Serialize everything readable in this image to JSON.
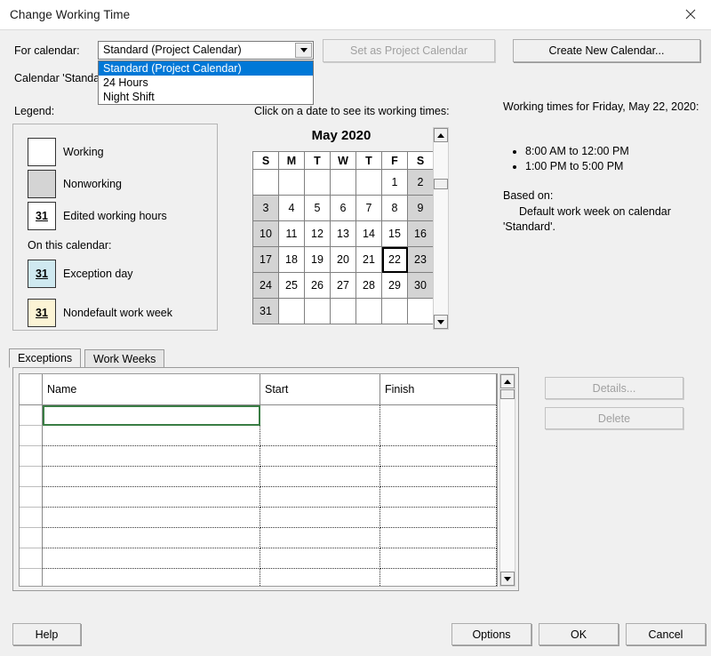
{
  "window": {
    "title": "Change Working Time",
    "close_icon": "close-icon"
  },
  "calendar_selector": {
    "label": "For calendar:",
    "value": "Standard (Project Calendar)",
    "dropdown_open": true,
    "options": [
      "Standard (Project Calendar)",
      "24 Hours",
      "Night Shift"
    ],
    "selected_index": 0,
    "set_as_project_calendar_label": "Set as Project Calendar",
    "set_as_project_calendar_enabled": false,
    "create_new_calendar_label": "Create New Calendar...",
    "calendar_description": "Calendar 'Standa"
  },
  "legend": {
    "title": "Legend:",
    "items": [
      {
        "label": "Working",
        "glyph": "",
        "fill": "#ffffff"
      },
      {
        "label": "Nonworking",
        "glyph": "",
        "fill": "#d4d4d4"
      },
      {
        "label": "Edited working hours",
        "glyph": "31",
        "fill": "#ffffff"
      }
    ],
    "subtitle": "On this calendar:",
    "cal_items": [
      {
        "label": "Exception day",
        "glyph": "31",
        "fill": "#cfe9f0"
      },
      {
        "label": "Nondefault work week",
        "glyph": "31",
        "fill": "#fcf4d5"
      }
    ]
  },
  "calendar": {
    "hint": "Click on a date to see its working times:",
    "month_title": "May 2020",
    "weekdays": [
      "S",
      "M",
      "T",
      "W",
      "T",
      "F",
      "S"
    ],
    "weeks": [
      [
        {
          "day": "",
          "type": "blank"
        },
        {
          "day": "",
          "type": "blank"
        },
        {
          "day": "",
          "type": "blank"
        },
        {
          "day": "",
          "type": "blank"
        },
        {
          "day": "",
          "type": "blank"
        },
        {
          "day": "1",
          "type": "working"
        },
        {
          "day": "2",
          "type": "nonworking"
        }
      ],
      [
        {
          "day": "3",
          "type": "nonworking"
        },
        {
          "day": "4",
          "type": "working"
        },
        {
          "day": "5",
          "type": "working"
        },
        {
          "day": "6",
          "type": "working"
        },
        {
          "day": "7",
          "type": "working"
        },
        {
          "day": "8",
          "type": "working"
        },
        {
          "day": "9",
          "type": "nonworking"
        }
      ],
      [
        {
          "day": "10",
          "type": "nonworking"
        },
        {
          "day": "11",
          "type": "working"
        },
        {
          "day": "12",
          "type": "working"
        },
        {
          "day": "13",
          "type": "working"
        },
        {
          "day": "14",
          "type": "working"
        },
        {
          "day": "15",
          "type": "working"
        },
        {
          "day": "16",
          "type": "nonworking"
        }
      ],
      [
        {
          "day": "17",
          "type": "nonworking"
        },
        {
          "day": "18",
          "type": "working"
        },
        {
          "day": "19",
          "type": "working"
        },
        {
          "day": "20",
          "type": "working"
        },
        {
          "day": "21",
          "type": "working"
        },
        {
          "day": "22",
          "type": "working",
          "selected": true
        },
        {
          "day": "23",
          "type": "nonworking"
        }
      ],
      [
        {
          "day": "24",
          "type": "nonworking"
        },
        {
          "day": "25",
          "type": "working"
        },
        {
          "day": "26",
          "type": "working"
        },
        {
          "day": "27",
          "type": "working"
        },
        {
          "day": "28",
          "type": "working"
        },
        {
          "day": "29",
          "type": "working"
        },
        {
          "day": "30",
          "type": "nonworking"
        }
      ],
      [
        {
          "day": "31",
          "type": "nonworking"
        },
        {
          "day": "",
          "type": "blank"
        },
        {
          "day": "",
          "type": "blank"
        },
        {
          "day": "",
          "type": "blank"
        },
        {
          "day": "",
          "type": "blank"
        },
        {
          "day": "",
          "type": "blank"
        },
        {
          "day": "",
          "type": "blank"
        }
      ]
    ],
    "selected_day": "22"
  },
  "working_times": {
    "title": "Working times for Friday, May 22, 2020:",
    "periods": [
      "8:00 AM to 12:00 PM",
      "1:00 PM to 5:00 PM"
    ],
    "based_on_label": "Based on:",
    "based_on_value": "Default work week on calendar 'Standard'."
  },
  "tabs": [
    {
      "label": "Exceptions",
      "active": true
    },
    {
      "label": "Work Weeks",
      "active": false
    }
  ],
  "exceptions_grid": {
    "columns": [
      "Name",
      "Start",
      "Finish"
    ],
    "rows": [
      {
        "name": "",
        "start": "",
        "finish": "",
        "editing": true
      },
      {
        "name": "",
        "start": "",
        "finish": ""
      },
      {
        "name": "",
        "start": "",
        "finish": ""
      },
      {
        "name": "",
        "start": "",
        "finish": ""
      },
      {
        "name": "",
        "start": "",
        "finish": ""
      },
      {
        "name": "",
        "start": "",
        "finish": ""
      },
      {
        "name": "",
        "start": "",
        "finish": ""
      },
      {
        "name": "",
        "start": "",
        "finish": ""
      },
      {
        "name": "",
        "start": "",
        "finish": ""
      }
    ]
  },
  "side_buttons": {
    "details_label": "Details...",
    "details_enabled": false,
    "delete_label": "Delete",
    "delete_enabled": false
  },
  "footer": {
    "help_label": "Help",
    "options_label": "Options",
    "ok_label": "OK",
    "cancel_label": "Cancel"
  },
  "colors": {
    "dialog_bg": "#f0f0f0",
    "highlight": "#0078d7",
    "nonworking": "#d4d4d4",
    "exception_day": "#cfe9f0",
    "nondefault_week": "#fcf4d5",
    "edit_cell_border": "#3a7d44"
  }
}
